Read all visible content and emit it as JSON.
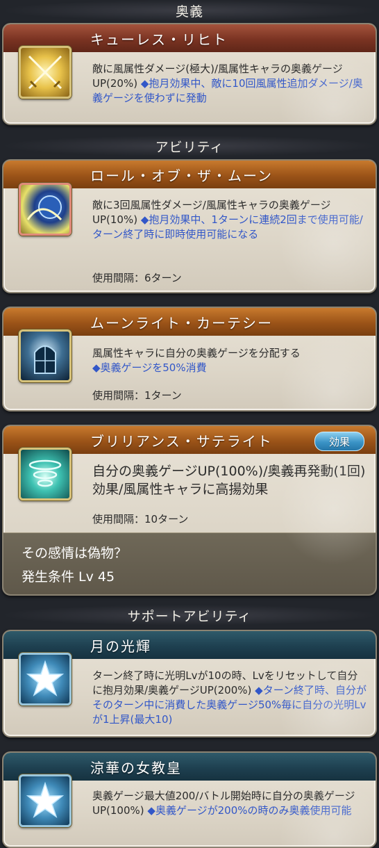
{
  "sections": {
    "ougi": "奥義",
    "ability": "アビリティ",
    "support": "サポートアビリティ"
  },
  "ougi": {
    "name": "キューレス・リヒト",
    "desc_plain": "敵に風属性ダメージ(極大)/風属性キャラの奥義ゲージUP(20%)",
    "desc_hl": "◆抱月効果中、敵に10回風属性追加ダメージ/奥義ゲージを使わずに発動",
    "icon": "crossed-swords-icon"
  },
  "abilities": [
    {
      "name": "ロール・オブ・ザ・ムーン",
      "desc_plain": "敵に3回風属性ダメージ/風属性キャラの奥義ゲージUP(10%)",
      "desc_hl": "◆抱月効果中、1ターンに連続2回まで使用可能/ターン終了時に即時使用可能になる",
      "usage": "使用間隔：6ターン",
      "icon": "moon-orb-icon"
    },
    {
      "name": "ムーンライト・カーテシー",
      "desc_plain": "風属性キャラに自分の奥義ゲージを分配する",
      "desc_hl": "◆奥義ゲージを50%消費",
      "usage": "使用間隔：1ターン",
      "icon": "moonlit-window-icon"
    },
    {
      "name": "ブリリアンス・サテライト",
      "desc_plain": "自分の奥義ゲージUP(100%)/奥義再発動(1回)効果/風属性キャラに高揚効果",
      "usage": "使用間隔：10ターン",
      "badge": "効果",
      "condition_title": "その感情は偽物？",
      "condition_req": "発生条件 Lv 45",
      "icon": "cyclone-icon"
    }
  ],
  "support": [
    {
      "name": "月の光輝",
      "desc_plain": "ターン終了時に光明Lvが10の時、Lvをリセットして自分に抱月効果/奥義ゲージUP(200%)",
      "desc_hl": "◆ターン終了時、自分がそのターン中に消費した奥義ゲージ50%毎に自分の光明Lvが1上昇(最大10)",
      "icon": "star-icon"
    },
    {
      "name": "涼華の女教皇",
      "desc_plain": "奥義ゲージ最大値200/バトル開始時に自分の奥義ゲージUP(100%)",
      "desc_hl": "◆奥義ゲージが200%の時のみ奥義使用可能",
      "icon": "star-icon"
    }
  ],
  "colors": {
    "highlight_text": "#3257c8",
    "ougi_bar": "#7a3322",
    "ability_bar": "#9b5318",
    "support_bar": "#1e4050",
    "badge": "#3a93c6"
  }
}
